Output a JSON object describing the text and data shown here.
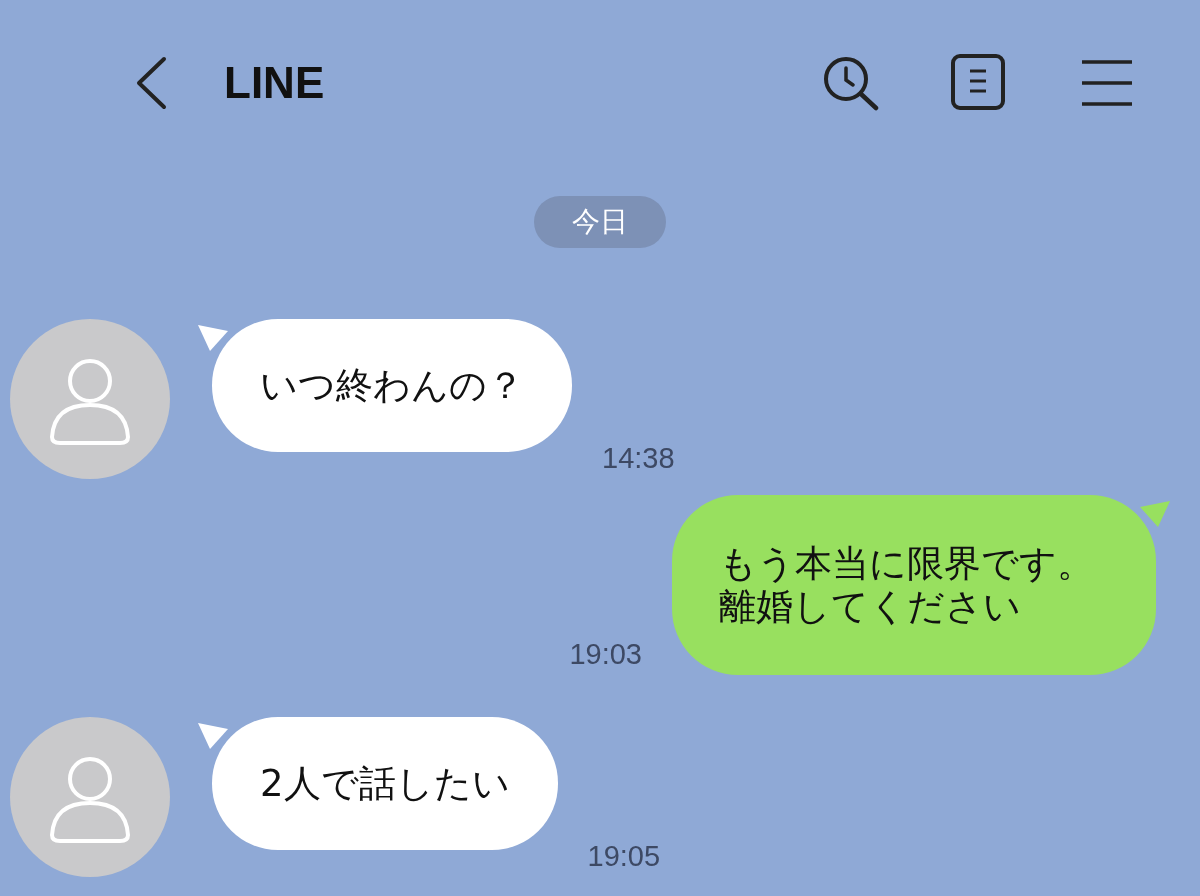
{
  "header": {
    "title": "LINE"
  },
  "date_label": "今日",
  "messages": [
    {
      "kind": "received",
      "lines": [
        "いつ終わんの？"
      ],
      "time": "14:38"
    },
    {
      "kind": "sent",
      "lines": [
        "もう本当に限界です。",
        "離婚してください"
      ],
      "time": "19:03"
    },
    {
      "kind": "received",
      "lines": [
        "2人で話したい"
      ],
      "time": "19:05"
    }
  ]
}
